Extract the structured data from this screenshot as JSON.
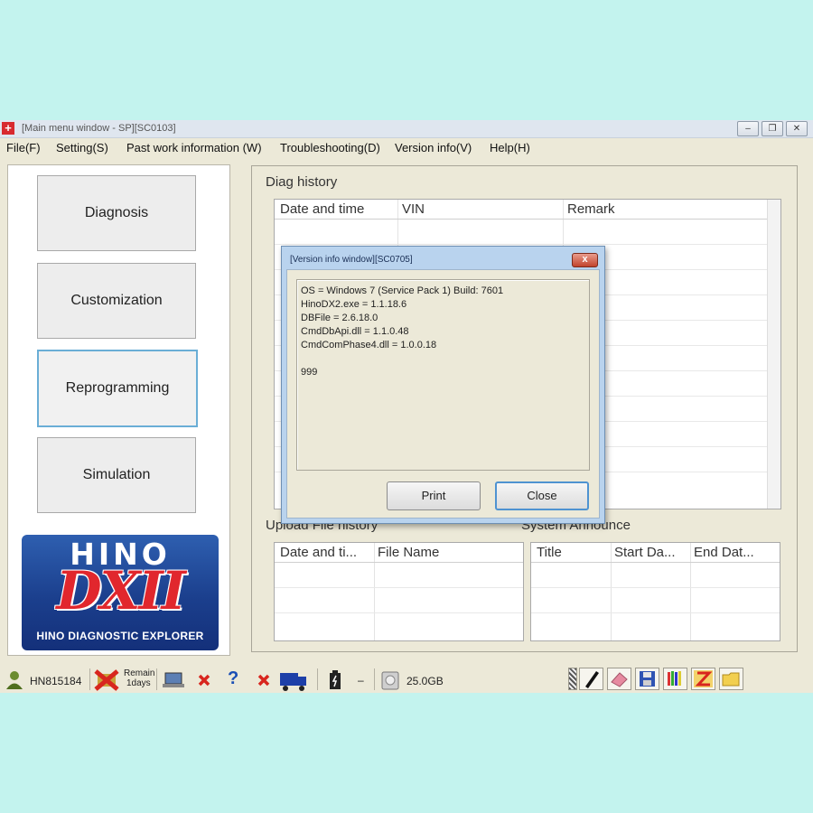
{
  "window": {
    "title": "[Main menu window - SP][SC0103]",
    "controls": {
      "minimize": "–",
      "maximize": "❐",
      "close": "✕"
    }
  },
  "menu": [
    {
      "label": "File(F)"
    },
    {
      "label": "Setting(S)"
    },
    {
      "label": "Past work information (W)"
    },
    {
      "label": "Troubleshooting(D)"
    },
    {
      "label": "Version info(V)"
    },
    {
      "label": "Help(H)"
    }
  ],
  "nav": {
    "buttons": [
      {
        "label": "Diagnosis"
      },
      {
        "label": "Customization"
      },
      {
        "label": "Reprogramming",
        "selected": true
      },
      {
        "label": "Simulation"
      }
    ]
  },
  "logo": {
    "line1": "HINO",
    "line2": "DXII",
    "tagline": "HINO DIAGNOSTIC EXPLORER"
  },
  "diag_history": {
    "title": "Diag history",
    "columns": [
      "Date and time",
      "VIN",
      "Remark"
    ]
  },
  "upload_history": {
    "title": "Upload File history",
    "columns": [
      "Date and ti...",
      "File Name"
    ]
  },
  "system_announce": {
    "title": "System Announce",
    "columns": [
      "Title",
      "Start Da...",
      "End Dat..."
    ]
  },
  "dialog": {
    "title": "[Version info window][SC0705]",
    "close_glyph": "x",
    "lines": [
      "OS = Windows 7 (Service Pack 1) Build: 7601",
      "HinoDX2.exe = 1.1.18.6",
      "DBFile = 2.6.18.0",
      "CmdDbApi.dll = 1.1.0.48",
      "CmdComPhase4.dll = 1.0.0.18",
      "",
      "999"
    ],
    "print_label": "Print",
    "close_label": "Close"
  },
  "status": {
    "user_id": "HN815184",
    "remain_line1": "Remain",
    "remain_line2": "1days",
    "battery_value": "–",
    "disk_free": "25.0GB"
  },
  "colors": {
    "background": "#c3f3ee",
    "window": "#ece9d8",
    "logo_blue": "#1b3f8d",
    "logo_red": "#e1272d",
    "dialog_frame": "#b9d3ee"
  }
}
